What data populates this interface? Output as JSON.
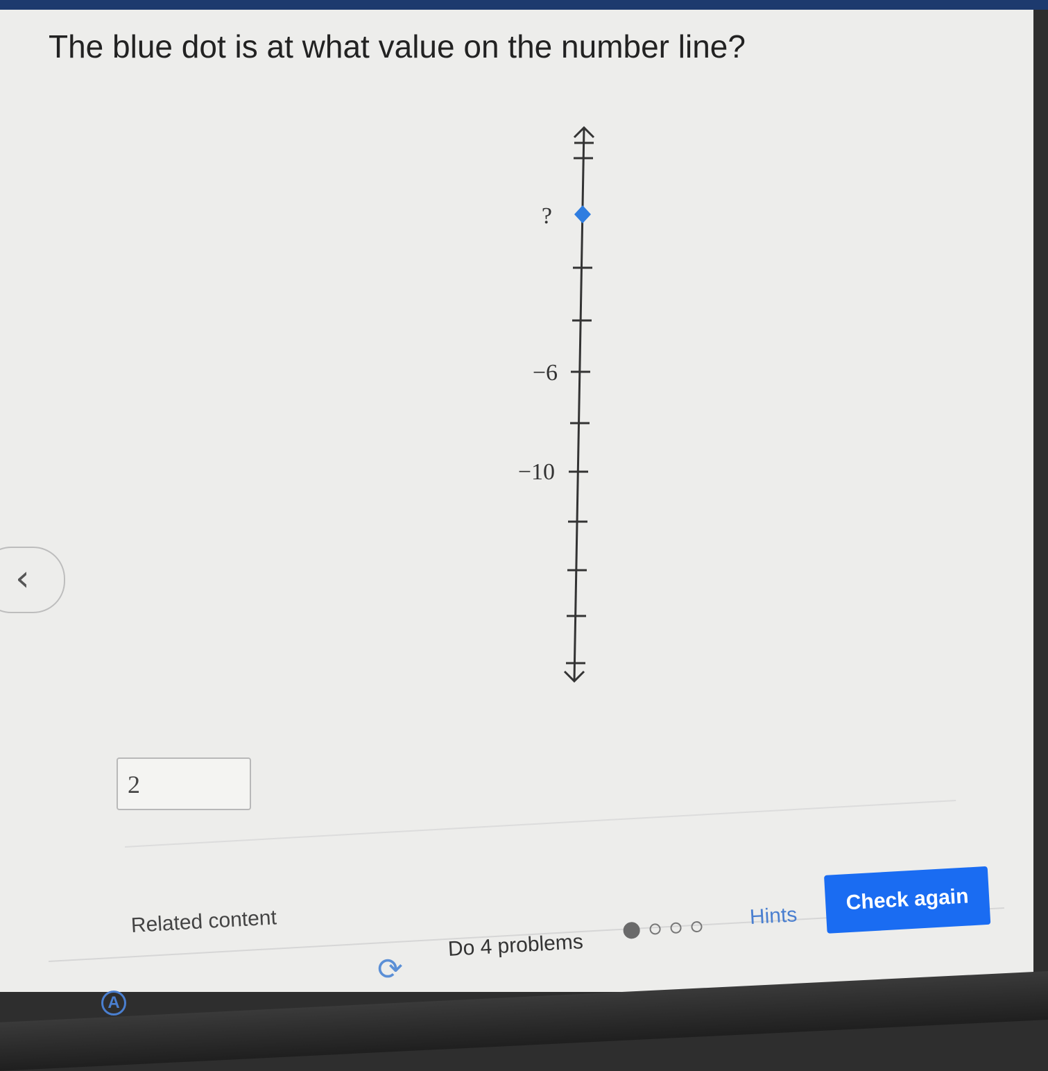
{
  "question": {
    "text": "The blue dot is at what value on the number line?"
  },
  "number_line": {
    "labels": [
      {
        "text": "?",
        "role": "blue-dot"
      },
      {
        "text": "−6",
        "value": -6
      },
      {
        "text": "−10",
        "value": -10
      }
    ],
    "dot_color": "#2f7de0"
  },
  "answer": {
    "value": "2"
  },
  "footer": {
    "related_content": "Related content",
    "do_problems": "Do 4 problems",
    "hints": "Hints",
    "check_button": "Check again",
    "progress": {
      "completed": 1,
      "total": 4
    }
  },
  "colors": {
    "accent": "#1a6cf2",
    "link": "#4a7fd0"
  }
}
